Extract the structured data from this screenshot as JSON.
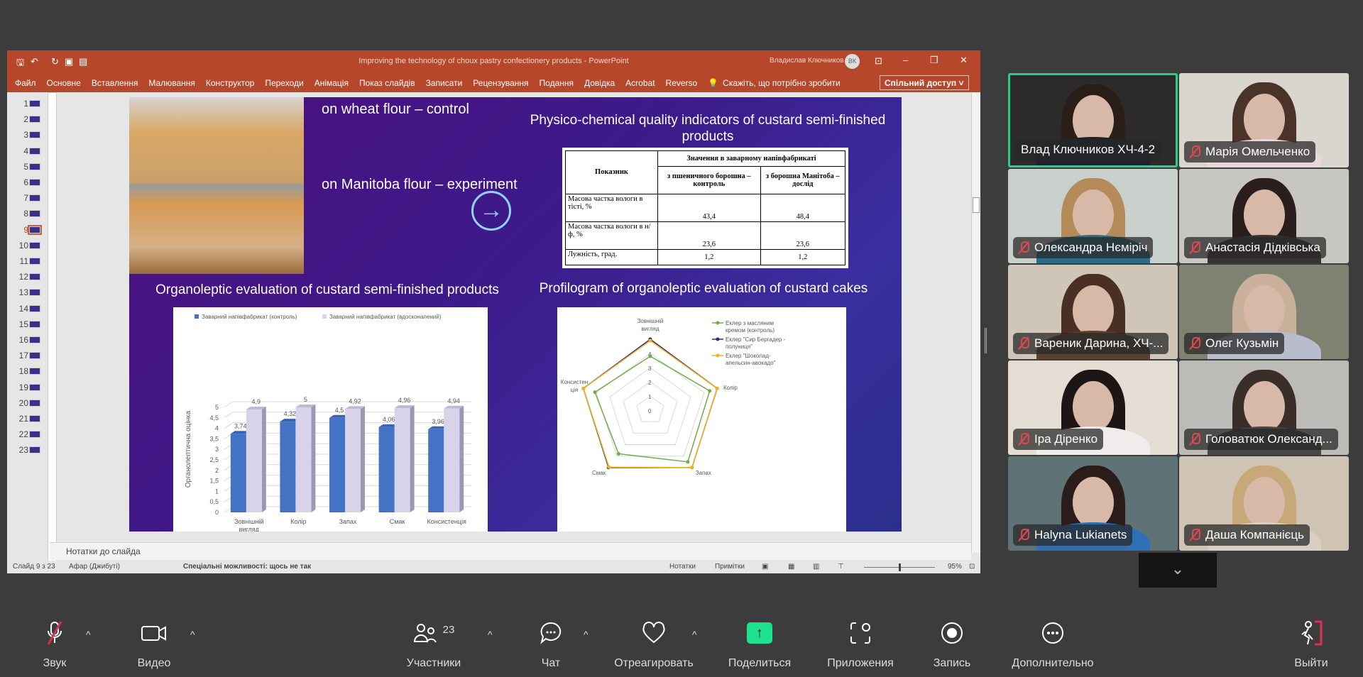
{
  "window": {
    "title": "Improving the technology of choux pastry confectionery products  -  PowerPoint",
    "user": "Владислав Ключников",
    "user_initials": "ВК",
    "share_button": "Спільний доступ",
    "tell_me": "Скажіть, що потрібно зробити"
  },
  "ribbon_tabs": [
    "Файл",
    "Основне",
    "Вставлення",
    "Малювання",
    "Конструктор",
    "Переходи",
    "Анімація",
    "Показ слайдів",
    "Записати",
    "Рецензування",
    "Подання",
    "Довідка",
    "Acrobat",
    "Reverso"
  ],
  "thumbnails": {
    "numbers": [
      "1",
      "2",
      "3",
      "4",
      "5",
      "6",
      "7",
      "8",
      "9",
      "10",
      "11",
      "12",
      "13",
      "14",
      "15",
      "16",
      "17",
      "18",
      "19",
      "20",
      "21",
      "22",
      "23"
    ],
    "selected": "9"
  },
  "slide": {
    "caption_control": "on wheat flour – control",
    "caption_experiment": "on Manitoba flour – experiment",
    "table_title": "Physico-chemical quality indicators of custard semi-finished products",
    "bar_title": "Organoleptic evaluation of custard semi-finished products",
    "radar_title": "Profilogram of organoleptic evaluation of custard cakes",
    "table": {
      "h_indicator": "Показник",
      "h_group": "Значення в заварному напівфабрикаті",
      "h_control": "з пшеничного борошна – контроль",
      "h_experiment": "з борошна Манітоба – дослід",
      "rows": [
        [
          "Масова частка вологи в тісті, %",
          "43,4",
          "48,4"
        ],
        [
          "Масова частка вологи в н/ф, %",
          "23,6",
          "23,6"
        ],
        [
          "Лужність, град.",
          "1,2",
          "1,2"
        ]
      ]
    }
  },
  "chart_data": [
    {
      "type": "bar",
      "title": "",
      "ylabel": "Органолептична оцінка",
      "ylim": [
        0,
        5
      ],
      "yticks": [
        "0",
        "0,5",
        "1",
        "1,5",
        "2",
        "2,5",
        "3",
        "3,5",
        "4",
        "4,5",
        "5"
      ],
      "categories": [
        "Зовнішній вигляд",
        "Колір",
        "Запах",
        "Смак",
        "Консистенція"
      ],
      "series": [
        {
          "name": "Заварний напівфабрикат (контроль)",
          "values": [
            3.74,
            4.32,
            4.5,
            4.06,
            3.96
          ],
          "labels": [
            "3,74",
            "4,32",
            "4,5",
            "4,06",
            "3,96"
          ],
          "color": "#4472c4"
        },
        {
          "name": "Заварний напівфабрикат (вдосконалений)",
          "values": [
            4.9,
            5,
            4.92,
            4.96,
            4.94
          ],
          "labels": [
            "4,9",
            "5",
            "4,92",
            "4,96",
            "4,94"
          ],
          "color": "#d9d3ea"
        }
      ],
      "legend": "top"
    },
    {
      "type": "radar",
      "axes": [
        "Зовнішній вигляд",
        "Колір",
        "Запах",
        "Смак",
        "Консистенція"
      ],
      "rlim": [
        0,
        5
      ],
      "rticks": [
        "0",
        "1",
        "2",
        "3",
        "4",
        "5"
      ],
      "series": [
        {
          "name": "Еклер з масляним кремом (контроль)",
          "values": [
            3.8,
            4.4,
            4.5,
            3.8,
            4.1
          ],
          "color": "#70ad47"
        },
        {
          "name": "Еклер \"Сир Бергадер - полуниця\"",
          "values": [
            5,
            4.95,
            5,
            5,
            4.95
          ],
          "color": "#2e2a7a"
        },
        {
          "name": "Еклер \"Шоколад-апельсин-авокадо\"",
          "values": [
            4.9,
            4.95,
            5,
            4.95,
            4.95
          ],
          "color": "#f2b31b"
        }
      ],
      "legend": "right"
    }
  ],
  "notes_placeholder": "Нотатки до слайда",
  "status": {
    "slide": "Слайд 9 з 23",
    "language": "Афар (Джибуті)",
    "accessibility": "Спеціальні можливості: щось не так",
    "notes": "Нотатки",
    "comments": "Примітки",
    "zoom": "95%",
    "zoom_fraction": 0.5
  },
  "participants": [
    {
      "name": "Влад Ключников ХЧ-4-2",
      "muted": false,
      "active": true,
      "bg": "#2c2a2a",
      "shirt": "#1c2230",
      "hair": "#2a1e18"
    },
    {
      "name": "Марія Омельченко",
      "muted": true,
      "bg": "#d9d6d0",
      "shirt": "#e8d8dc",
      "hair": "#4a3328"
    },
    {
      "name": "Олександра Нєміріч",
      "muted": true,
      "bg": "#c9cfca",
      "shirt": "#2e6b86",
      "hair": "#b38a58"
    },
    {
      "name": "Анастасія Дідківська",
      "muted": true,
      "bg": "#c8c6c0",
      "shirt": "#3a3230",
      "hair": "#2a1f1c"
    },
    {
      "name": "Вареник Дарина, ХЧ-...",
      "muted": true,
      "bg": "#cfc6b8",
      "shirt": "#5b4030",
      "hair": "#4a3024"
    },
    {
      "name": "Олег Кузьмін",
      "muted": true,
      "bg": "#7f8270",
      "shirt": "#b8bccc",
      "hair": "#c8b09a"
    },
    {
      "name": "Іра Діренко",
      "muted": true,
      "bg": "#e3ddd3",
      "shirt": "#f0ecec",
      "hair": "#1e1614"
    },
    {
      "name": "Головатюк Олександ...",
      "muted": true,
      "bg": "#bdbbb8",
      "shirt": "#4a4644",
      "hair": "#3a2e28"
    },
    {
      "name": "Halyna Lukianets",
      "muted": true,
      "bg": "#5f7376",
      "shirt": "#2f6fb8",
      "hair": "#2a1c18"
    },
    {
      "name": "Даша Компанієць",
      "muted": true,
      "bg": "#cfc4b4",
      "shirt": "#d8cfc2",
      "hair": "#c8a878"
    }
  ],
  "toolbar": {
    "audio": "Звук",
    "video": "Видео",
    "participants": "Участники",
    "participants_count": "23",
    "chat": "Чат",
    "react": "Отреагировать",
    "share": "Поделиться",
    "apps": "Приложения",
    "record": "Запись",
    "more": "Дополнительно",
    "leave": "Выйти",
    "share_color": "#1de18f"
  }
}
